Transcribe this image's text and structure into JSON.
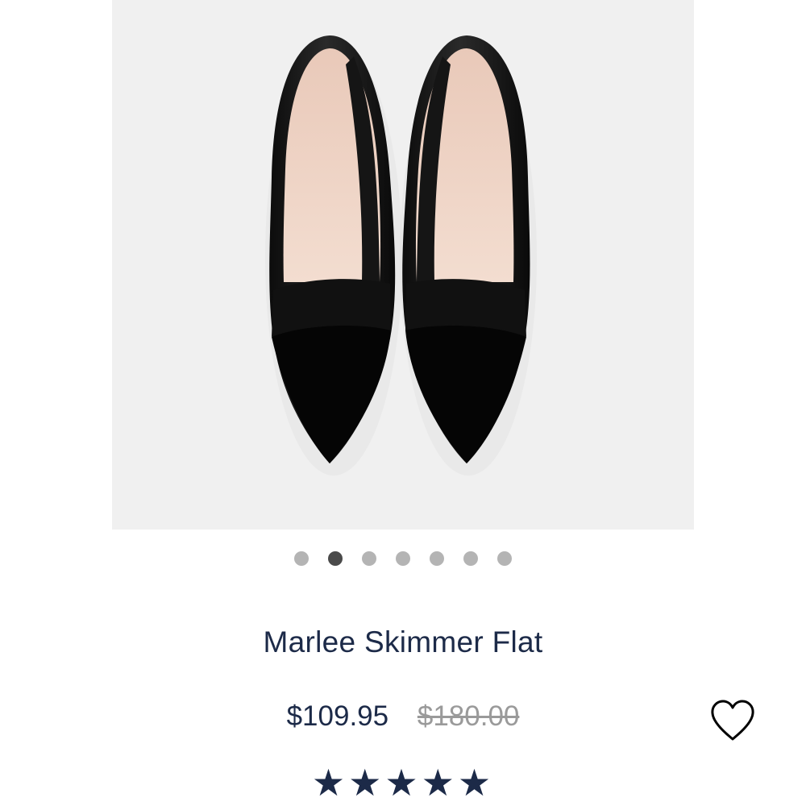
{
  "product": {
    "title": "Marlee Skimmer Flat",
    "image_alt_name": "black-pointed-skimmer-flats",
    "price_sale": "$109.95",
    "price_original": "$180.00",
    "rating_stars": "★★★★★",
    "rating_value": 5,
    "rating_max": 5
  },
  "carousel": {
    "total_images": 7,
    "active_index": 1
  },
  "wishlist": {
    "icon": "heart-outline-icon"
  },
  "colors": {
    "title_text": "#1c2a48",
    "dot_inactive": "#b4b4b4",
    "dot_active": "#4a4a4a",
    "original_price": "#9a9a9a",
    "image_bg": "#f0f0f0"
  }
}
